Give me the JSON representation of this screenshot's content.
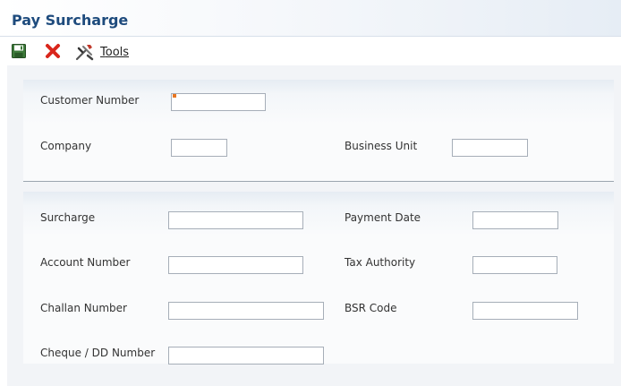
{
  "header": {
    "title": "Pay Surcharge"
  },
  "toolbar": {
    "save_icon": "floppy-disk-icon",
    "cancel_icon": "red-x-icon",
    "tools_icon": "tools-icon",
    "tools_label_first": "T",
    "tools_label_rest": "ools"
  },
  "form": {
    "customer_number": {
      "label": "Customer Number",
      "value": ""
    },
    "company": {
      "label": "Company",
      "value": ""
    },
    "business_unit": {
      "label": "Business Unit",
      "value": ""
    },
    "surcharge": {
      "label": "Surcharge",
      "value": ""
    },
    "payment_date": {
      "label": "Payment Date",
      "value": ""
    },
    "account_number": {
      "label": "Account Number",
      "value": ""
    },
    "tax_authority": {
      "label": "Tax Authority",
      "value": ""
    },
    "challan_number": {
      "label": "Challan Number",
      "value": ""
    },
    "bsr_code": {
      "label": "BSR Code",
      "value": ""
    },
    "cheque_dd_number": {
      "label": "Cheque / DD Number",
      "value": ""
    }
  },
  "colors": {
    "title": "#1e4b7d",
    "required_marker": "#e87722",
    "cancel": "#d9261c"
  }
}
